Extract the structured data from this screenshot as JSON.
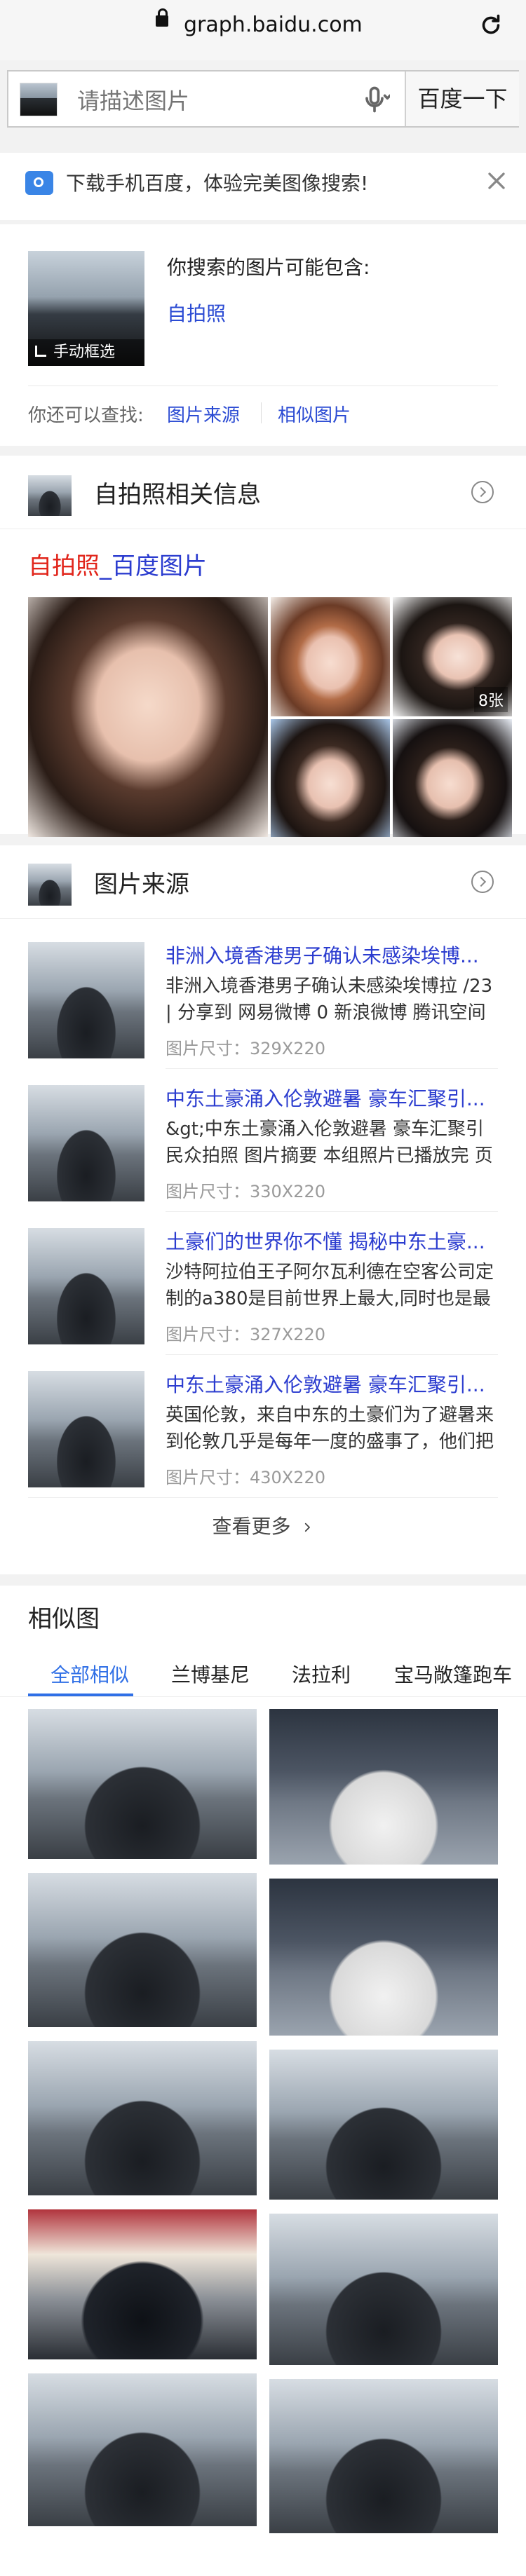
{
  "browser": {
    "url": "graph.baidu.com"
  },
  "search": {
    "placeholder": "请描述图片",
    "button": "百度一下"
  },
  "banner": {
    "text": "下载手机百度，体验完美图像搜索!"
  },
  "contains": {
    "heading": "你搜索的图片可能包含:",
    "tag": "自拍照",
    "manual": "手动框选",
    "also_prefix": "你还可以查找:",
    "link_source": "图片来源",
    "link_similar": "相似图片"
  },
  "related": {
    "title": "自拍照相关信息",
    "result_title_keyword": "自拍照",
    "result_title_rest": "_百度图片",
    "count_badge": "8张"
  },
  "source": {
    "title": "图片来源",
    "items": [
      {
        "title": "非洲入境香港男子确认未感染埃博...",
        "desc": "非洲入境香港男子确认未感染埃博拉 /23 | 分享到 网易微博 0 新浪微博 腾讯空间",
        "size": "图片尺寸：329X220"
      },
      {
        "title": "中东土豪涌入伦敦避暑 豪车汇聚引...",
        "desc": "&gt;中东土豪涌入伦敦避暑 豪车汇聚引民众拍照 图片摘要 本组照片已播放完 页面",
        "size": "图片尺寸：330X220"
      },
      {
        "title": "土豪们的世界你不懂 揭秘中东土豪...",
        "desc": "沙特阿拉伯王子阿尔瓦利德在空客公司定制的a380是目前世界上最大,同时也是最",
        "size": "图片尺寸：327X220"
      },
      {
        "title": "中东土豪涌入伦敦避暑 豪车汇聚引...",
        "desc": "英国伦敦，来自中东的土豪们为了避暑来到伦敦几乎是每年一度的盛事了，他们把",
        "size": "图片尺寸：430X220"
      }
    ],
    "more": "查看更多"
  },
  "similar": {
    "title": "相似图",
    "tabs": [
      "全部相似",
      "兰博基尼",
      "法拉利",
      "宝马敞篷跑车"
    ],
    "active_tab_index": 0
  },
  "colors": {
    "accent_blue": "#2f6fe6",
    "link_blue": "#2b4bd3",
    "title_red": "#e1251b"
  }
}
